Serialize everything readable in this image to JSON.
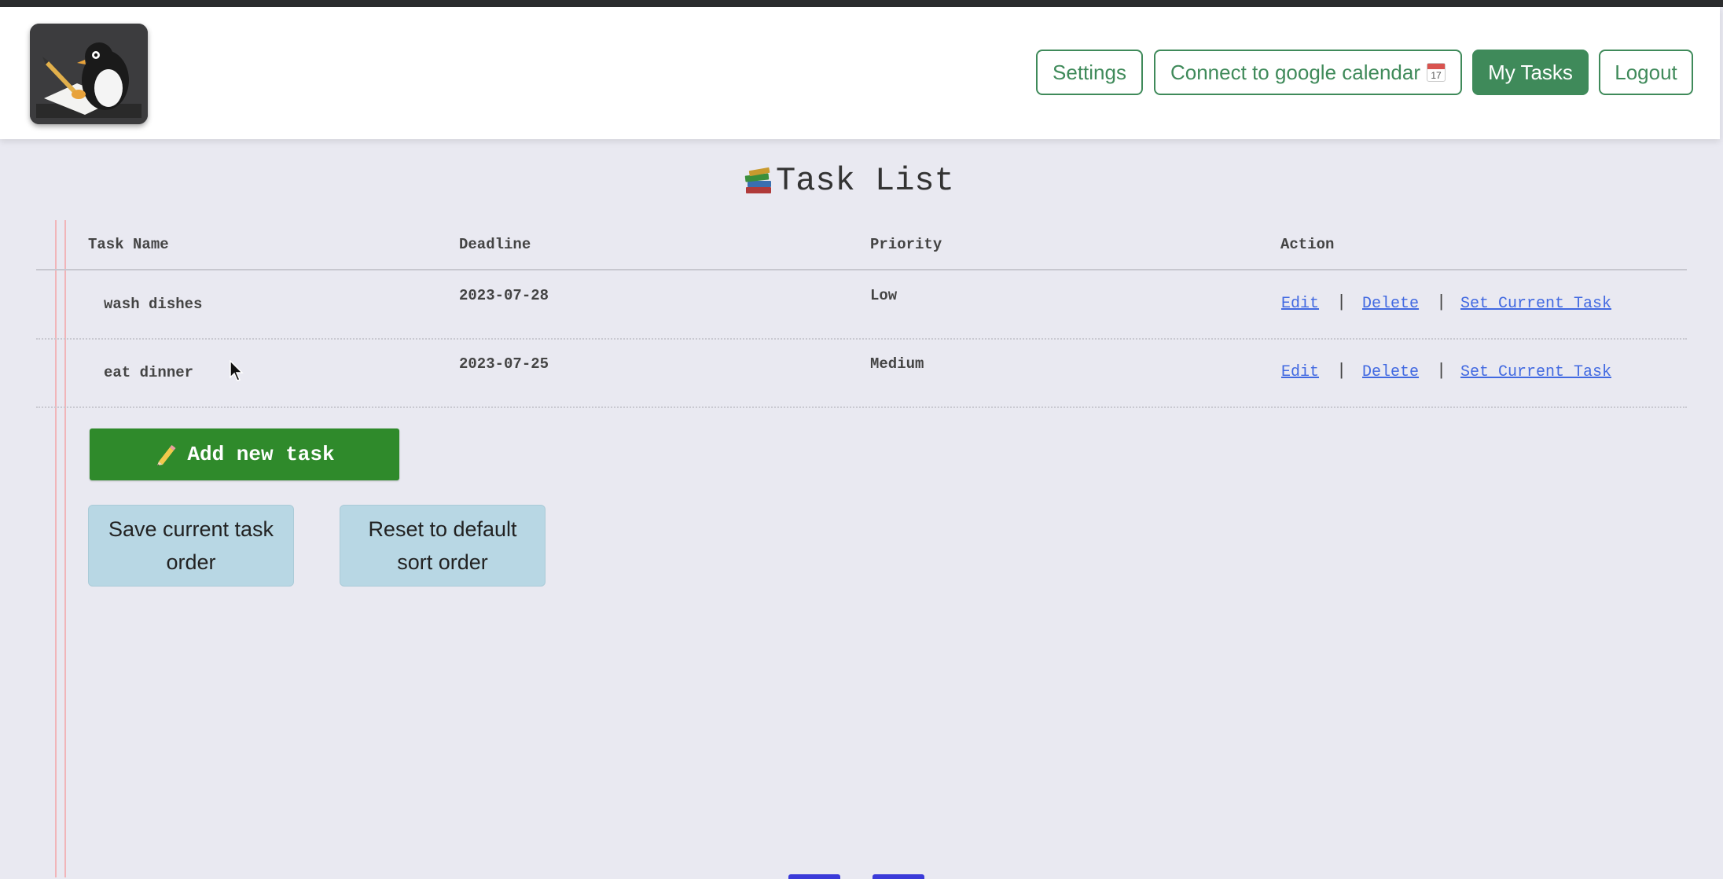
{
  "nav": {
    "buttons": {
      "settings": "Settings",
      "connect_calendar": "Connect to google calendar",
      "my_tasks": "My Tasks",
      "logout": "Logout"
    },
    "calendar_icon_day": "17"
  },
  "page": {
    "title": "Task List"
  },
  "table": {
    "headers": {
      "task_name": "Task Name",
      "deadline": "Deadline",
      "priority": "Priority",
      "action": "Action"
    },
    "rows": [
      {
        "name": "wash dishes",
        "deadline": "2023-07-28",
        "priority": "Low"
      },
      {
        "name": "eat dinner",
        "deadline": "2023-07-25",
        "priority": "Medium"
      }
    ],
    "actions": {
      "edit": "Edit",
      "delete": "Delete",
      "set_current": "Set Current Task",
      "separator": "|"
    }
  },
  "buttons": {
    "add_task": "Add new task",
    "save_order": "Save current task order",
    "reset_order": "Reset to default sort order"
  },
  "colors": {
    "accent_green": "#3f8a5a",
    "add_button_green": "#2f8a2b",
    "link_blue": "#4169e1",
    "light_button": "#b8d7e4",
    "background": "#e9e9f1"
  }
}
